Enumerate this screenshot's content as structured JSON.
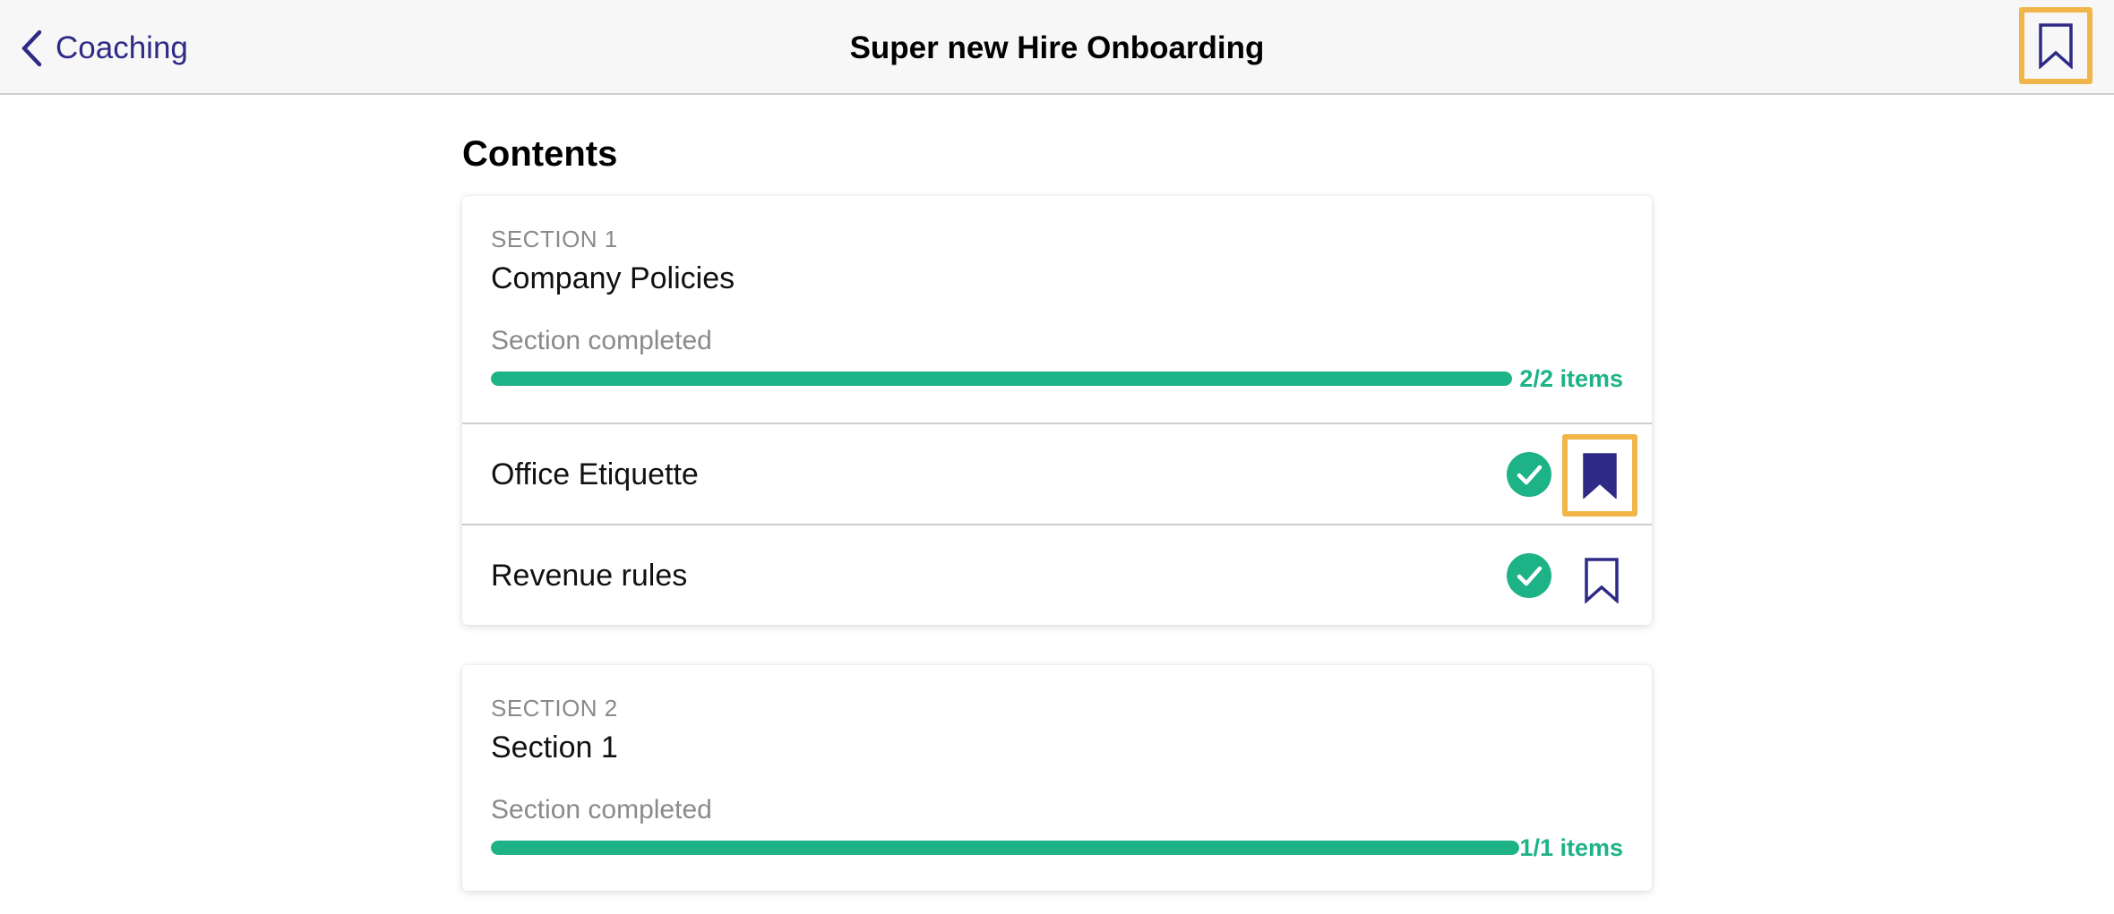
{
  "navbar": {
    "back_label": "Coaching",
    "title": "Super new Hire Onboarding",
    "bookmark_icon": "bookmark-outline-icon"
  },
  "contents_heading": "Contents",
  "colors": {
    "accent": "#2e2a86",
    "success": "#1db386",
    "highlight": "#f2b54a",
    "muted": "#8a8a8a"
  },
  "sections": [
    {
      "label": "SECTION 1",
      "title": "Company Policies",
      "status": "Section completed",
      "progress_fraction": 1.0,
      "progress_count": "2/2 items",
      "items": [
        {
          "title": "Office Etiquette",
          "completed": true,
          "bookmarked": true
        },
        {
          "title": "Revenue rules",
          "completed": true,
          "bookmarked": false
        }
      ]
    },
    {
      "label": "SECTION 2",
      "title": "Section 1",
      "status": "Section completed",
      "progress_fraction": 1.0,
      "progress_count": "1/1 items",
      "items": []
    }
  ]
}
